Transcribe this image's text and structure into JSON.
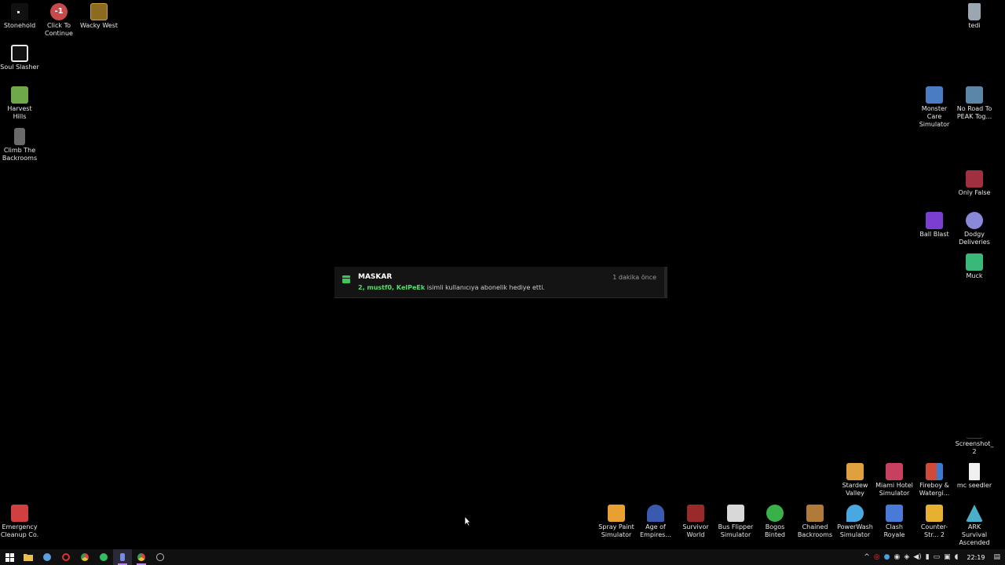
{
  "desktop": {
    "icons": [
      {
        "id": "stonehold",
        "label": "Stonehold",
        "color": "#1a1a1a"
      },
      {
        "id": "click-to-continue",
        "label": "Click To Continue",
        "color": "#c94a4a",
        "badge": "-1"
      },
      {
        "id": "wacky-west",
        "label": "Wacky West",
        "color": "#8b6b1f"
      },
      {
        "id": "tedi",
        "label": "tedi",
        "color": "#9aa6b2"
      },
      {
        "id": "soul-slasher",
        "label": "Soul Slasher",
        "color": "#e8e8e8"
      },
      {
        "id": "harvest-hills",
        "label": "Harvest Hills",
        "color": "#6fa84a"
      },
      {
        "id": "monster-care",
        "label": "Monster Care Simulator",
        "color": "#4a7cc4"
      },
      {
        "id": "no-road",
        "label": "No Road To PEAK Tog...",
        "color": "#5b86a8"
      },
      {
        "id": "climb-backrooms",
        "label": "Climb The Backrooms",
        "color": "#6a6a6a"
      },
      {
        "id": "only-false",
        "label": "Only False",
        "color": "#a03040"
      },
      {
        "id": "ball-blast",
        "label": "Ball Blast",
        "color": "#7a3fd0"
      },
      {
        "id": "dodgy-deliveries",
        "label": "Dodgy Deliveries",
        "color": "#8a88d8"
      },
      {
        "id": "muck",
        "label": "Muck",
        "color": "#3ab87a"
      },
      {
        "id": "screenshot2",
        "label": "Screenshot_2",
        "color": "#000000"
      },
      {
        "id": "stardew",
        "label": "Stardew Valley",
        "color": "#e0a040"
      },
      {
        "id": "miami-hotel",
        "label": "Miami Hotel Simulator",
        "color": "#c84060"
      },
      {
        "id": "fireboy",
        "label": "Fireboy & Watergi...",
        "color": "#d04a3a"
      },
      {
        "id": "mc-seedler",
        "label": "mc seedler",
        "color": "#f0f0f0"
      },
      {
        "id": "emergency",
        "label": "Emergency Cleanup Co.",
        "color": "#d04040"
      },
      {
        "id": "spray-paint",
        "label": "Spray Paint Simulator",
        "color": "#e8a030"
      },
      {
        "id": "age-empires",
        "label": "Age of Empires...",
        "color": "#3a5ab0"
      },
      {
        "id": "survivor-world",
        "label": "Survivor World",
        "color": "#9a2a2a"
      },
      {
        "id": "bus-flipper",
        "label": "Bus Flipper Simulator",
        "color": "#d8d8d8"
      },
      {
        "id": "bogos-binted",
        "label": "Bogos Binted",
        "color": "#3ab04a"
      },
      {
        "id": "chained-backrooms",
        "label": "Chained Backrooms",
        "color": "#b07a3a"
      },
      {
        "id": "powerwash",
        "label": "PowerWash Simulator",
        "color": "#4aa8e0"
      },
      {
        "id": "clash-royale",
        "label": "Clash Royale",
        "color": "#4a7ad8"
      },
      {
        "id": "counter-strike",
        "label": "Counter-Str... 2",
        "color": "#e8b030"
      },
      {
        "id": "ark",
        "label": "ARK Survival Ascended",
        "color": "#48b0c8"
      }
    ]
  },
  "notification": {
    "title": "MASKAR",
    "time": "1 dakika önce",
    "count_names": "2, mustf0, KelPeEk",
    "message_rest": " isimli kullanıcıya abonelik hediye etti."
  },
  "taskbar": {
    "apps": [
      {
        "id": "start",
        "icon": "windows-icon",
        "color": "#ffffff"
      },
      {
        "id": "explorer",
        "icon": "folder-icon",
        "color": "#e8c050"
      },
      {
        "id": "steam",
        "icon": "steam-icon",
        "color": "#5aa0e0"
      },
      {
        "id": "opera",
        "icon": "opera-icon",
        "color": "#e03030"
      },
      {
        "id": "chrome1",
        "icon": "chrome-icon",
        "color": "#e8c030"
      },
      {
        "id": "spotify",
        "icon": "spotify-icon",
        "color": "#30c060"
      },
      {
        "id": "app-active",
        "icon": "app-icon",
        "color": "#7a8ae8",
        "active": true
      },
      {
        "id": "chrome2",
        "icon": "chrome-icon",
        "color": "#e05040",
        "active": true
      },
      {
        "id": "obs",
        "icon": "obs-icon",
        "color": "#bbbbbb"
      }
    ],
    "clock": "22:19"
  }
}
